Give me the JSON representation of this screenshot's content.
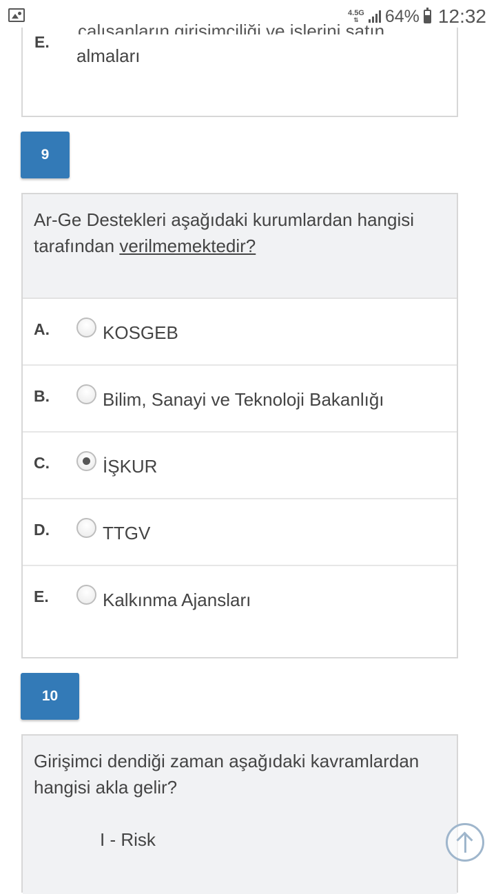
{
  "status_bar": {
    "network_type": "4.5G",
    "battery_percent": "64%",
    "battery_level": 0.64,
    "time": "12:32"
  },
  "previous_question": {
    "option_letter": "E.",
    "option_text_cut": "çalışanların girişimciliği ve işlerini satın",
    "option_text": "almaları"
  },
  "question_9": {
    "number": "9",
    "text_before": "Ar-Ge Destekleri aşağıdaki kurumlardan hangisi tarafından ",
    "text_underlined": "verilmemektedir?",
    "options": [
      {
        "letter": "A.",
        "text": "KOSGEB",
        "selected": false
      },
      {
        "letter": "B.",
        "text": "Bilim, Sanayi ve Teknoloji Bakanlığı",
        "selected": false
      },
      {
        "letter": "C.",
        "text": "İŞKUR",
        "selected": true
      },
      {
        "letter": "D.",
        "text": "TTGV",
        "selected": false
      },
      {
        "letter": "E.",
        "text": "Kalkınma Ajansları",
        "selected": false
      }
    ]
  },
  "question_10": {
    "number": "10",
    "text": "Girişimci dendiği zaman aşağıdaki kavramlardan hangisi akla gelir?",
    "item_1": "I - Risk"
  },
  "colors": {
    "badge_blue": "#337ab7",
    "question_bg": "#f1f2f4",
    "border": "#d7d7d7"
  },
  "icons": {
    "status_left": "image-icon",
    "scroll_top": "arrow-up-circle-icon"
  }
}
